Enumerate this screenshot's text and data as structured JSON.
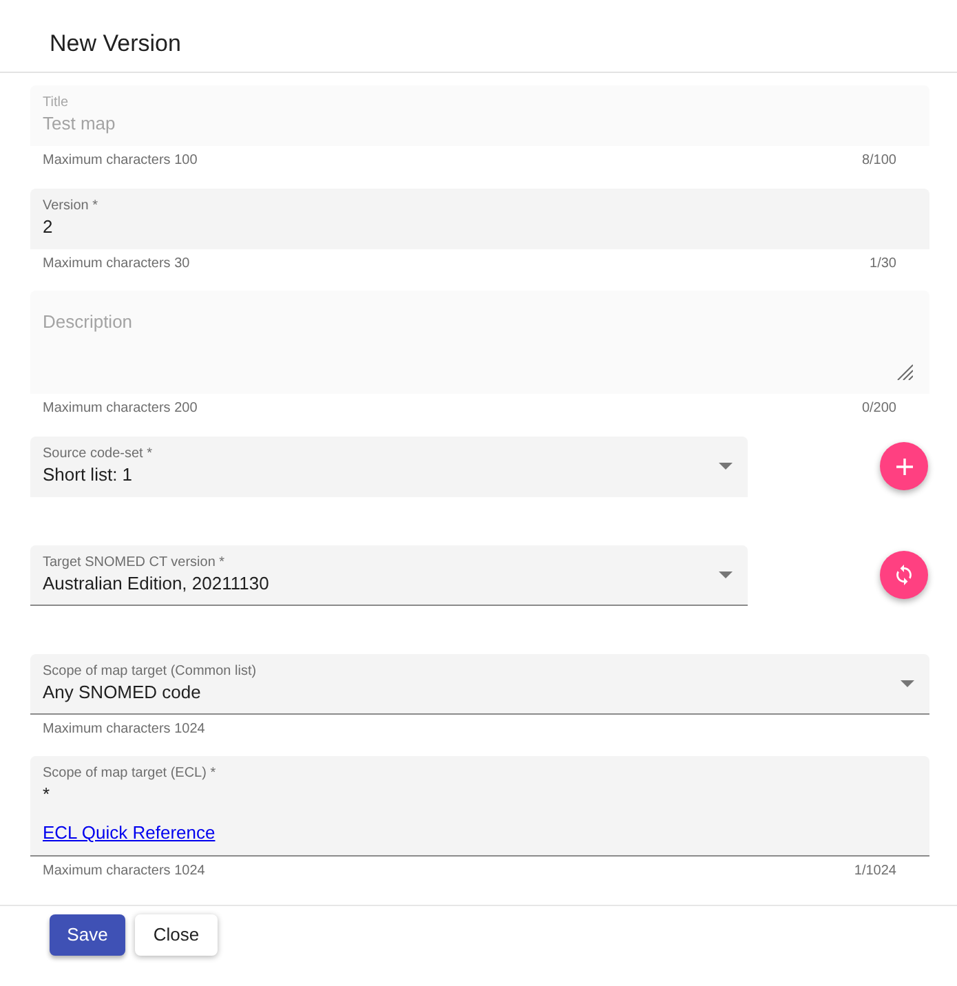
{
  "dialog": {
    "title": "New Version"
  },
  "fields": [
    {
      "kind": "text",
      "label": "Title",
      "value": "Test map",
      "disabled": true,
      "underlined": false,
      "helper": "Maximum characters 100",
      "counter": "8/100"
    },
    {
      "kind": "text",
      "label": "Version *",
      "value": "2",
      "disabled": false,
      "underlined": false,
      "helper": "Maximum characters 30",
      "counter": "1/30"
    },
    {
      "kind": "textarea",
      "label": "Description",
      "disabled": true,
      "underlined": false,
      "helper": "Maximum characters 200",
      "counter": "0/200"
    },
    {
      "kind": "select",
      "label": "Source code-set *",
      "value": "Short list: 1",
      "disabled": false,
      "underlined": false,
      "action_button": {
        "kind": "add"
      }
    },
    {
      "kind": "select",
      "label": "Target SNOMED CT version *",
      "value": "Australian Edition, 20211130",
      "disabled": false,
      "underlined": true,
      "action_button": {
        "kind": "refresh"
      }
    },
    {
      "kind": "select",
      "label": "Scope of map target (Common list)",
      "value": "Any SNOMED code",
      "disabled": false,
      "underlined": true,
      "helper": "Maximum characters 1024"
    },
    {
      "kind": "text",
      "label": "Scope of map target (ECL) *",
      "value": "*",
      "disabled": false,
      "underlined": true,
      "link": "ECL Quick Reference",
      "helper": "Maximum characters 1024",
      "counter": "1/1024"
    }
  ],
  "buttons": [
    {
      "label": "Save",
      "kind": "primary"
    },
    {
      "label": "Close",
      "kind": "plain"
    }
  ]
}
